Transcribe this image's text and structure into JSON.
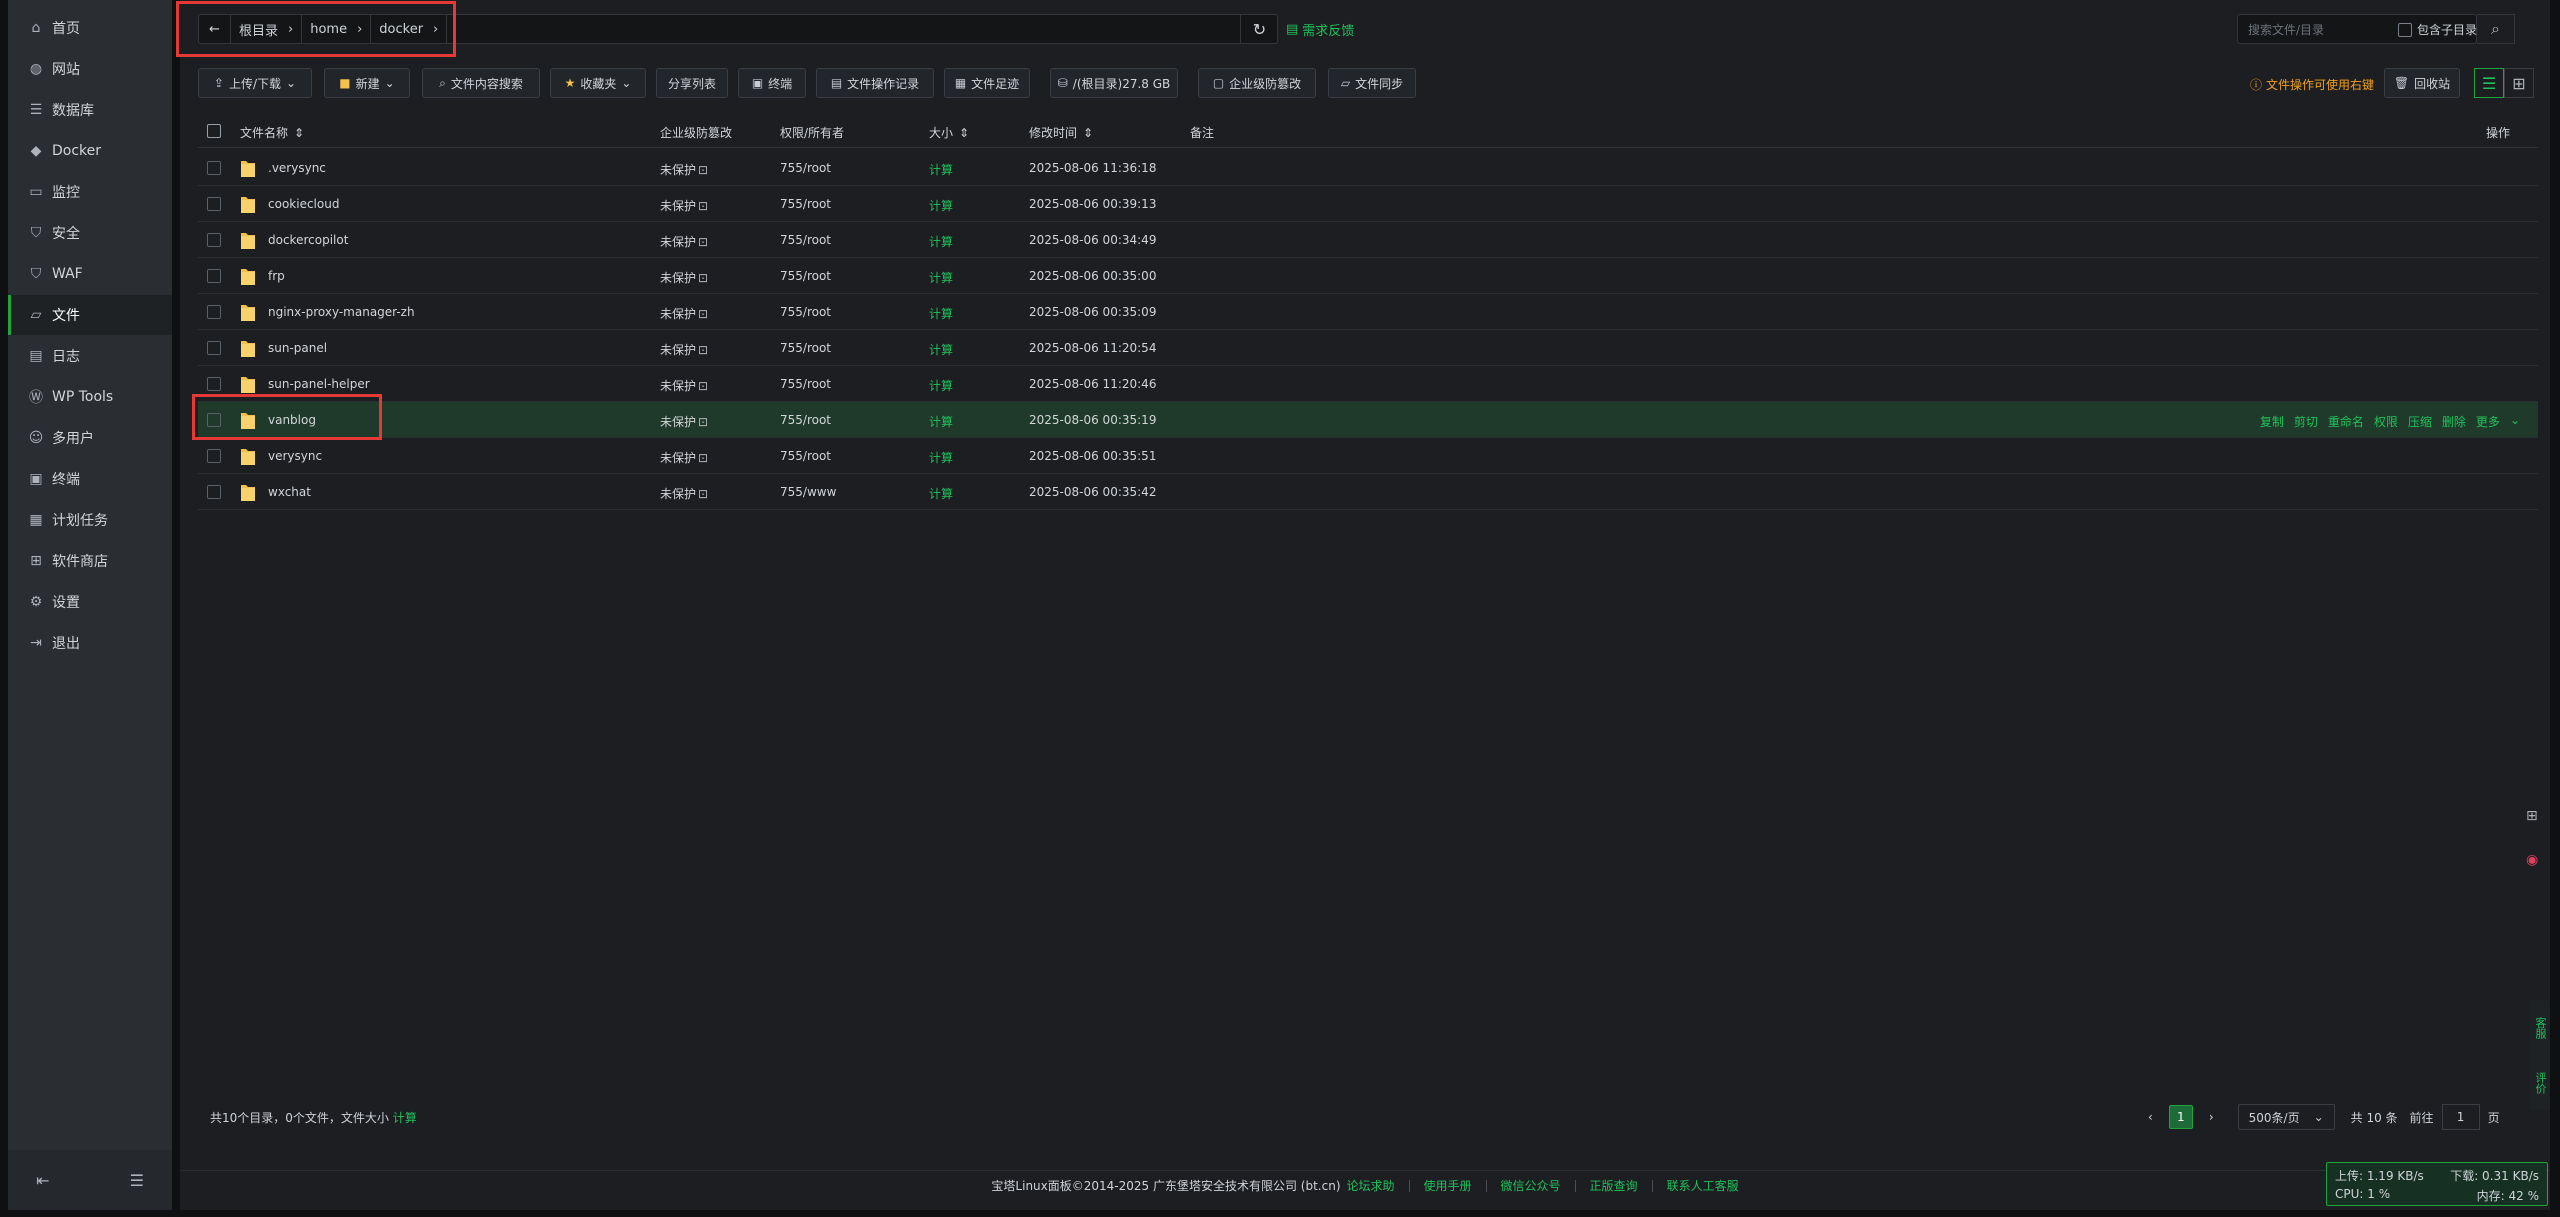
{
  "sidebar": {
    "items": [
      {
        "label": "首页",
        "icon": "home-icon"
      },
      {
        "label": "网站",
        "icon": "globe-icon"
      },
      {
        "label": "数据库",
        "icon": "database-icon"
      },
      {
        "label": "Docker",
        "icon": "docker-icon"
      },
      {
        "label": "监控",
        "icon": "monitor-icon"
      },
      {
        "label": "安全",
        "icon": "shield-icon"
      },
      {
        "label": "WAF",
        "icon": "waf-icon"
      },
      {
        "label": "文件",
        "icon": "folder-icon",
        "active": true
      },
      {
        "label": "日志",
        "icon": "log-icon"
      },
      {
        "label": "WP Tools",
        "icon": "wordpress-icon"
      },
      {
        "label": "多用户",
        "icon": "users-icon"
      },
      {
        "label": "终端",
        "icon": "terminal-icon"
      },
      {
        "label": "计划任务",
        "icon": "calendar-icon"
      },
      {
        "label": "软件商店",
        "icon": "grid-icon"
      },
      {
        "label": "设置",
        "icon": "gear-icon"
      },
      {
        "label": "退出",
        "icon": "logout-icon"
      }
    ]
  },
  "breadcrumb": {
    "items": [
      "根目录",
      "home",
      "docker"
    ]
  },
  "topbar": {
    "feedback_label": "需求反馈",
    "search_placeholder": "搜索文件/目录",
    "include_sub_label": "包含子目录"
  },
  "toolbar": {
    "buttons": [
      "上传/下载",
      "新建",
      "文件内容搜索",
      "收藏夹",
      "分享列表",
      "终端",
      "文件操作记录",
      "文件足迹",
      "/(根目录)27.8 GB",
      "企业级防篡改",
      "文件同步"
    ],
    "warning": "文件操作可使用右键",
    "recycle_label": "回收站"
  },
  "table": {
    "headers": {
      "name": "文件名称",
      "protect": "企业级防篡改",
      "perm": "权限/所有者",
      "size": "大小",
      "mtime": "修改时间",
      "note": "备注",
      "ops": "操作"
    },
    "rows": [
      {
        "name": ".verysync",
        "protect": "未保护",
        "perm": "755/root",
        "size": "计算",
        "mtime": "2025-08-06 11:36:18"
      },
      {
        "name": "cookiecloud",
        "protect": "未保护",
        "perm": "755/root",
        "size": "计算",
        "mtime": "2025-08-06 00:39:13"
      },
      {
        "name": "dockercopilot",
        "protect": "未保护",
        "perm": "755/root",
        "size": "计算",
        "mtime": "2025-08-06 00:34:49"
      },
      {
        "name": "frp",
        "protect": "未保护",
        "perm": "755/root",
        "size": "计算",
        "mtime": "2025-08-06 00:35:00"
      },
      {
        "name": "nginx-proxy-manager-zh",
        "protect": "未保护",
        "perm": "755/root",
        "size": "计算",
        "mtime": "2025-08-06 00:35:09"
      },
      {
        "name": "sun-panel",
        "protect": "未保护",
        "perm": "755/root",
        "size": "计算",
        "mtime": "2025-08-06 11:20:54"
      },
      {
        "name": "sun-panel-helper",
        "protect": "未保护",
        "perm": "755/root",
        "size": "计算",
        "mtime": "2025-08-06 11:20:46"
      },
      {
        "name": "vanblog",
        "protect": "未保护",
        "perm": "755/root",
        "size": "计算",
        "mtime": "2025-08-06 00:35:19",
        "hovered": true
      },
      {
        "name": "verysync",
        "protect": "未保护",
        "perm": "755/root",
        "size": "计算",
        "mtime": "2025-08-06 00:35:51"
      },
      {
        "name": "wxchat",
        "protect": "未保护",
        "perm": "755/www",
        "size": "计算",
        "mtime": "2025-08-06 00:35:42"
      }
    ],
    "row_ops": [
      "复制",
      "剪切",
      "重命名",
      "权限",
      "压缩",
      "删除",
      "更多"
    ]
  },
  "footer": {
    "summary": "共10个目录，0个文件，文件大小",
    "summary_calc": "计算",
    "page_current": "1",
    "page_size": "500条/页",
    "total": "共 10 条",
    "goto_label": "前往",
    "goto_value": "1",
    "page_unit": "页"
  },
  "copyright": {
    "text": "宝塔Linux面板©2014-2025 广东堡塔安全技术有限公司 (bt.cn)",
    "links": [
      "论坛求助",
      "使用手册",
      "微信公众号",
      "正版查询",
      "联系人工客服"
    ]
  },
  "netstat": {
    "upload": "上传: 1.19 KB/s",
    "download": "下载: 0.31 KB/s",
    "cpu": "CPU: 1 %",
    "mem": "内存: 42 %"
  },
  "service": {
    "label": "客服",
    "review": "评价"
  },
  "colors": {
    "accent": "#20a53a",
    "annotation": "#e53935",
    "warning": "#f0a020"
  }
}
